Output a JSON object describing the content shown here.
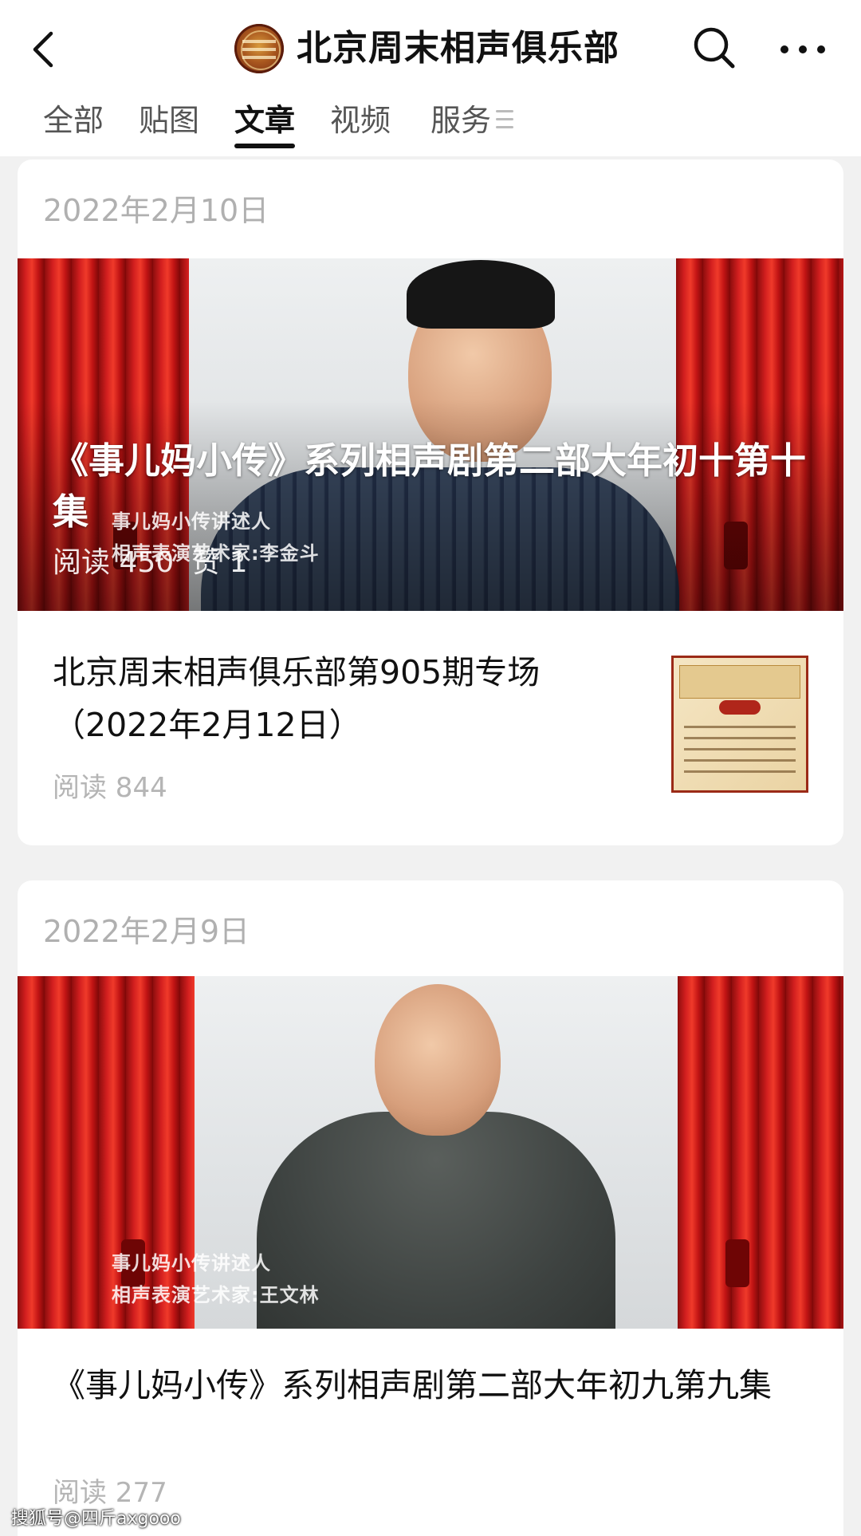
{
  "header": {
    "account_name": "北京周末相声俱乐部",
    "back_icon": "chevron-left-icon",
    "search_icon": "search-icon",
    "more_icon": "more-dots-icon"
  },
  "tabs": [
    {
      "label": "全部",
      "active": false
    },
    {
      "label": "贴图",
      "active": false
    },
    {
      "label": "文章",
      "active": true
    },
    {
      "label": "视频",
      "active": false
    },
    {
      "label": "服务",
      "active": false
    }
  ],
  "groups": [
    {
      "date": "2022年2月10日",
      "featured": {
        "title": "《事儿妈小传》系列相声剧第二部大年初十第十集",
        "reads": "阅读 450",
        "likes": "赞 1",
        "caption_line1": "事儿妈小传讲述人",
        "caption_line2": "相声表演艺术家:李金斗"
      },
      "article": {
        "title": "北京周末相声俱乐部第905期专场（2022年2月12日）",
        "reads": "阅读 844"
      }
    },
    {
      "date": "2022年2月9日",
      "featured": {
        "caption_line1": "事儿妈小传讲述人",
        "caption_line2": "相声表演艺术家:王文林"
      },
      "article": {
        "title": "《事儿妈小传》系列相声剧第二部大年初九第九集",
        "reads": "阅读 277"
      }
    }
  ],
  "watermark": "搜狐号@四斤axgooo",
  "colors": {
    "background": "#f1f1f1",
    "card": "#ffffff",
    "curtain_red": "#d21f1f",
    "muted_text": "#b0b0b0"
  }
}
